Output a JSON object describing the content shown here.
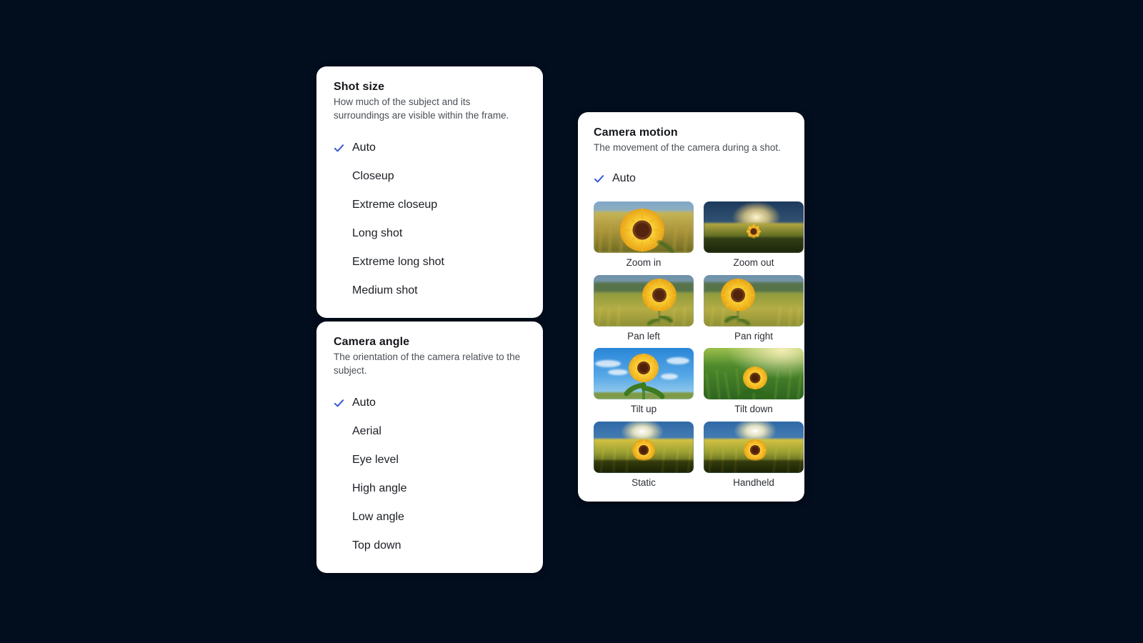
{
  "theme": {
    "background": "#020d1e",
    "card_background": "#ffffff",
    "accent_check": "#3557d6",
    "title_color": "#15171c",
    "description_color": "#4a4f57"
  },
  "panels": {
    "shot_size": {
      "title": "Shot size",
      "description": "How much of the subject and its surroundings are visible within the frame.",
      "options": [
        {
          "label": "Auto",
          "selected": true
        },
        {
          "label": "Closeup",
          "selected": false
        },
        {
          "label": "Extreme closeup",
          "selected": false
        },
        {
          "label": "Long shot",
          "selected": false
        },
        {
          "label": "Extreme long shot",
          "selected": false
        },
        {
          "label": "Medium shot",
          "selected": false
        }
      ]
    },
    "camera_angle": {
      "title": "Camera angle",
      "description": "The orientation of the camera relative to the subject.",
      "options": [
        {
          "label": "Auto",
          "selected": true
        },
        {
          "label": "Aerial",
          "selected": false
        },
        {
          "label": "Eye level",
          "selected": false
        },
        {
          "label": "High angle",
          "selected": false
        },
        {
          "label": "Low angle",
          "selected": false
        },
        {
          "label": "Top down",
          "selected": false
        }
      ]
    },
    "camera_motion": {
      "title": "Camera motion",
      "description": "The movement of the camera during a shot.",
      "auto_option": {
        "label": "Auto",
        "selected": true
      },
      "thumbnails": [
        {
          "label": "Zoom in",
          "scene": "close-sunflower-golden-field"
        },
        {
          "label": "Zoom out",
          "scene": "distant-sunflower-dusk-sun"
        },
        {
          "label": "Pan left",
          "scene": "sunflower-right-of-frame-meadow"
        },
        {
          "label": "Pan right",
          "scene": "sunflower-left-of-frame-meadow"
        },
        {
          "label": "Tilt up",
          "scene": "sunflower-against-blue-sky"
        },
        {
          "label": "Tilt down",
          "scene": "sunflower-in-green-grass-overhead"
        },
        {
          "label": "Static",
          "scene": "sunflower-field-sunburst"
        },
        {
          "label": "Handheld",
          "scene": "sunflower-field-sunburst"
        }
      ]
    }
  },
  "icons": {
    "check": "check-icon"
  }
}
